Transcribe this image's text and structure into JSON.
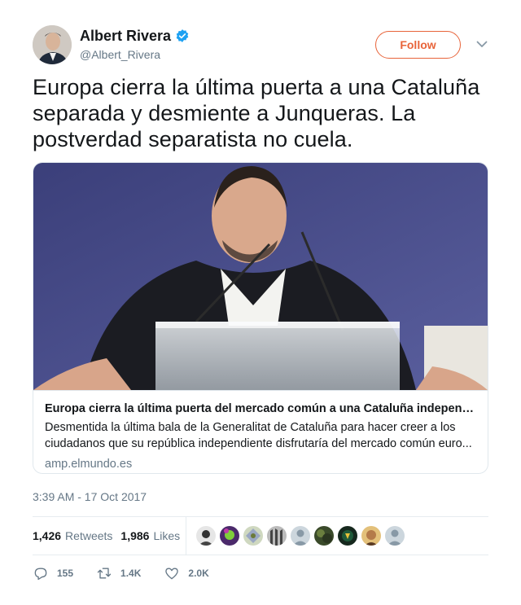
{
  "author": {
    "display_name": "Albert Rivera",
    "handle": "@Albert_Rivera",
    "verified": true
  },
  "follow_label": "Follow",
  "tweet_text": "Europa cierra la última puerta a una Cataluña separada y desmiente a Junqueras. La postverdad separatista no cuela.",
  "card": {
    "title": "Europa cierra la última puerta del mercado común a una Cataluña independie...",
    "description": "Desmentida la última bala de la Generalitat de Cataluña para hacer creer a los ciudadanos que su república independiente disfrutaría del mercado común euro...",
    "domain": "amp.elmundo.es"
  },
  "timestamp": "3:39 AM - 17 Oct 2017",
  "stats": {
    "retweets_count": "1,426",
    "retweets_label": "Retweets",
    "likes_count": "1,986",
    "likes_label": "Likes"
  },
  "actions": {
    "reply_count": "155",
    "retweet_count": "1.4K",
    "like_count": "2.0K"
  },
  "colors": {
    "accent": "#e8643a",
    "verified": "#1da1f2",
    "muted": "#657786"
  }
}
